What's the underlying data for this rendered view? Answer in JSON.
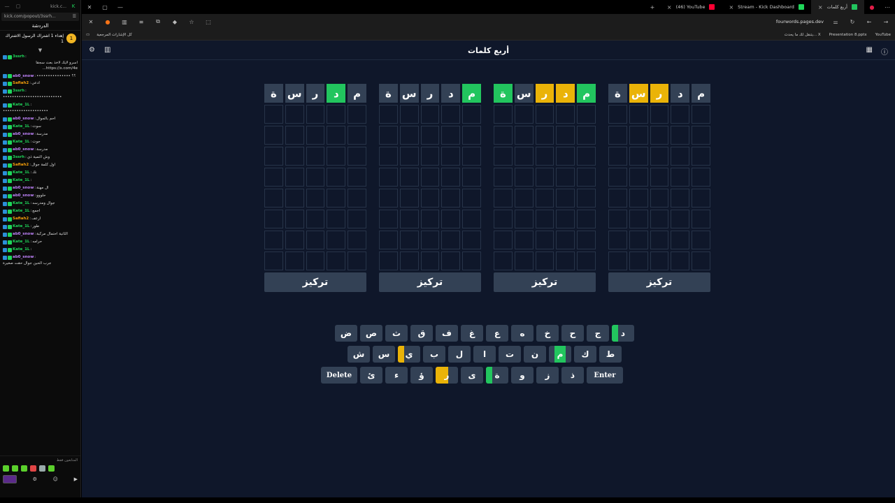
{
  "chat": {
    "title_tabs": [
      "kick.c..."
    ],
    "url": "kick.com/popout/3ssrh...",
    "header": "الدردشة",
    "pinned_badge": "1",
    "pinned_text": "إهداء 1 اشتراك الرسول الاشتراك 1",
    "drop_icon": "▼",
    "messages": [
      {
        "user": "3ssrh",
        "text": "اسرو لايك لاخذ بعث سجقا https://x.com/4e...",
        "color": "#1fd65a"
      },
      {
        "user": "ab0_snow",
        "text": "؟؟ •••••••••••••••",
        "color": "#c084fc"
      },
      {
        "user": "Safiah2",
        "text": "ادعي",
        "color": "#f59e0b"
      },
      {
        "user": "3ssrh",
        "text": "••••••••••••••••••••••••••",
        "color": "#1fd65a"
      },
      {
        "user": "Kate_1L",
        "text": "••••••••••••••••••••",
        "color": "#1fd65a"
      },
      {
        "user": "ab0_snow",
        "text": "احم بالجوال",
        "color": "#c084fc"
      },
      {
        "user": "Kate_1L",
        "text": "سوت",
        "color": "#1fd65a"
      },
      {
        "user": "ab0_snow",
        "text": "مدرسة",
        "color": "#c084fc"
      },
      {
        "user": "Kate_1L",
        "text": "جوت",
        "color": "#1fd65a"
      },
      {
        "user": "ab0_snow",
        "text": "مدرسة",
        "color": "#c084fc"
      },
      {
        "user": "3ssrh",
        "text": "وش التمية ذي",
        "color": "#1fd65a"
      },
      {
        "user": "Safiah2",
        "text": "اول كلمة جوال",
        "color": "#f59e0b"
      },
      {
        "user": "Kate_1L",
        "text": "نك",
        "color": "#1fd65a"
      },
      {
        "user": "Kate_1L",
        "text": "",
        "color": "#1fd65a"
      },
      {
        "user": "ab0_snow",
        "text": "ال مهنة",
        "color": "#c084fc"
      },
      {
        "user": "ab0_snow",
        "text": "حلووو",
        "color": "#c084fc"
      },
      {
        "user": "Kate_1L",
        "text": "جوال ومدرسه",
        "color": "#1fd65a"
      },
      {
        "user": "Kate_1L",
        "text": "اجمع",
        "color": "#1fd65a"
      },
      {
        "user": "Safiah2",
        "text": "ارعف",
        "color": "#f59e0b"
      },
      {
        "user": "Kate_1L",
        "text": "طور",
        "color": "#1fd65a"
      },
      {
        "user": "ab0_snow",
        "text": "الثانية احتمال مركبة",
        "color": "#c084fc"
      },
      {
        "user": "Kate_1L",
        "text": "حرامه",
        "color": "#1fd65a"
      },
      {
        "user": "Kate_1L",
        "text": "",
        "color": "#1fd65a"
      },
      {
        "user": "ab0_snow",
        "text": "جرب الحين جوال حقت صغيرة",
        "color": "#c084fc"
      }
    ],
    "viewers_label": "المتابعون فقط"
  },
  "browser": {
    "tabs": [
      {
        "label": "أربع كلمات",
        "active": true,
        "icon_color": "#22c55e"
      },
      {
        "label": "Stream - Kick Dashboard",
        "active": false,
        "icon_color": "#1fd65a"
      },
      {
        "label": "(46) YouTube",
        "active": false,
        "icon_color": "#ff0033"
      }
    ],
    "address": "fourwords.pages.dev",
    "bookmarks_left": "كل الإشارات المرجعية",
    "bookmarks_right": [
      "يتنقل لك ما يحدث... X",
      "Presentation 8.pptx",
      "YouTube"
    ]
  },
  "game": {
    "title": "أربع كلمات",
    "focus_label": "تركيز",
    "colors": {
      "green": "#22c55e",
      "yellow": "#eab308",
      "key": "#334155",
      "bg": "#0f172a"
    },
    "boards": [
      {
        "guess": [
          "م",
          "د",
          "ر",
          "س",
          "ة"
        ],
        "states": [
          "n",
          "n",
          "y",
          "y",
          "n"
        ]
      },
      {
        "guess": [
          "م",
          "د",
          "ر",
          "س",
          "ة"
        ],
        "states": [
          "g",
          "y",
          "y",
          "n",
          "g"
        ]
      },
      {
        "guess": [
          "م",
          "د",
          "ر",
          "س",
          "ة"
        ],
        "states": [
          "g",
          "n",
          "n",
          "n",
          "n"
        ]
      },
      {
        "guess": [
          "م",
          "د",
          "ر",
          "س",
          "ة"
        ],
        "states": [
          "n",
          "g",
          "n",
          "n",
          "n"
        ]
      }
    ],
    "keyboard": {
      "row1": [
        {
          "k": "د",
          "m": "strip-g"
        },
        {
          "k": "ج",
          "m": ""
        },
        {
          "k": "ح",
          "m": ""
        },
        {
          "k": "خ",
          "m": ""
        },
        {
          "k": "ه",
          "m": ""
        },
        {
          "k": "ع",
          "m": ""
        },
        {
          "k": "غ",
          "m": ""
        },
        {
          "k": "ف",
          "m": ""
        },
        {
          "k": "ق",
          "m": ""
        },
        {
          "k": "ث",
          "m": ""
        },
        {
          "k": "ص",
          "m": ""
        },
        {
          "k": "ض",
          "m": ""
        }
      ],
      "row2": [
        {
          "k": "ط",
          "m": ""
        },
        {
          "k": "ك",
          "m": ""
        },
        {
          "k": "م",
          "m": "full-g"
        },
        {
          "k": "ن",
          "m": ""
        },
        {
          "k": "ت",
          "m": ""
        },
        {
          "k": "ا",
          "m": ""
        },
        {
          "k": "ل",
          "m": ""
        },
        {
          "k": "ب",
          "m": ""
        },
        {
          "k": "ي",
          "m": "strip-y"
        },
        {
          "k": "س",
          "m": ""
        },
        {
          "k": "ش",
          "m": ""
        }
      ],
      "row3": [
        {
          "k": "Enter",
          "m": "wide"
        },
        {
          "k": "ذ",
          "m": ""
        },
        {
          "k": "ز",
          "m": ""
        },
        {
          "k": "و",
          "m": ""
        },
        {
          "k": "ة",
          "m": "strip-g"
        },
        {
          "k": "ى",
          "m": ""
        },
        {
          "k": "ر",
          "m": "full-y-half"
        },
        {
          "k": "ؤ",
          "m": ""
        },
        {
          "k": "ء",
          "m": ""
        },
        {
          "k": "ئ",
          "m": ""
        },
        {
          "k": "Delete",
          "m": "wide"
        }
      ]
    }
  }
}
